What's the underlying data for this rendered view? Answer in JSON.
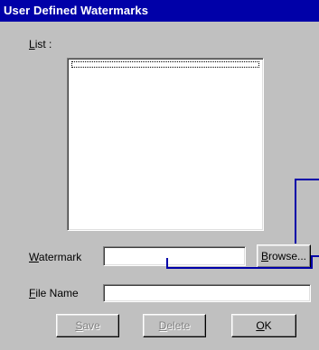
{
  "window": {
    "title": "User Defined Watermarks"
  },
  "list": {
    "label": "List :",
    "items": [
      ""
    ]
  },
  "watermark": {
    "label": "Watermark",
    "value": ""
  },
  "browse": {
    "label": "Browse..."
  },
  "file_name": {
    "label": "File Name",
    "value": ""
  },
  "buttons": {
    "save": "Save",
    "delete": "Delete",
    "ok": "OK"
  },
  "colors": {
    "titlebar": "#0000a8",
    "face": "#c0c0c0",
    "callout": "#0000a8"
  }
}
